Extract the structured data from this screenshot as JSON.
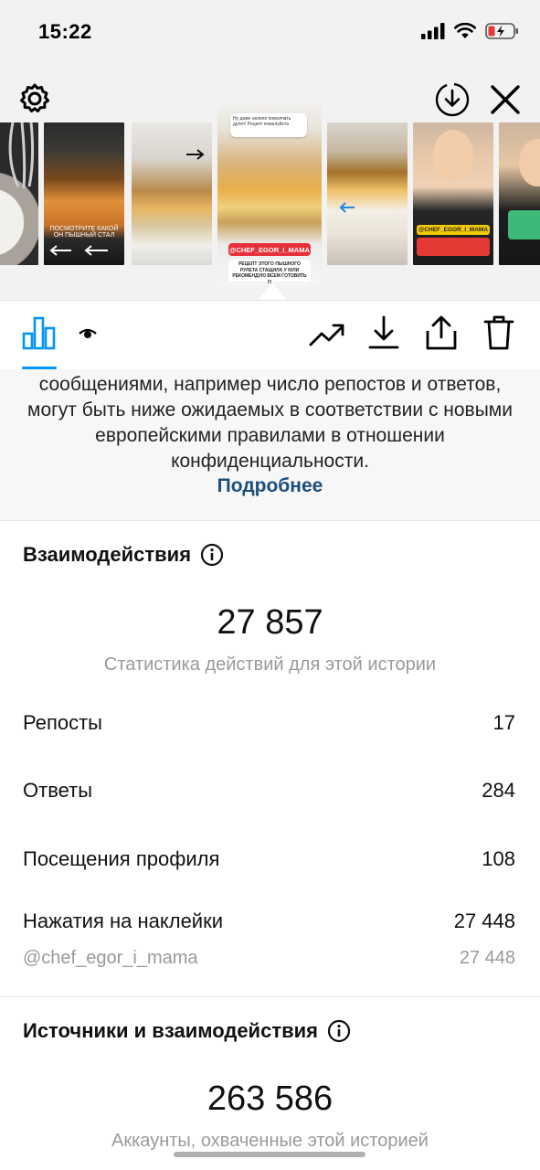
{
  "status_bar": {
    "time": "15:22"
  },
  "story_strip": {
    "thumbnails": [
      {
        "caption": ""
      },
      {
        "caption": "ПОСМОТРИТЕ КАКОЙ ОН ПЫШНЫЙ СТАЛ"
      },
      {
        "caption": ""
      },
      {
        "caption": "@CHEF_EGOR_I_MAMA"
      },
      {
        "caption": ""
      },
      {
        "caption": "@CHEF_EGOR_I_MAMA"
      },
      {
        "caption": ""
      }
    ],
    "selected_top_text": "Ну даже нелепо помолчать дулет! Рецепт пожалуйста",
    "selected_bottom_text": "РЕЦЕПТ ЭТОГО ПЫШНОГО РУЛЕТА СТАЩИЛА У ЮЛИ РЕКОМЕНДУЮ ВСЕМ ГОТОВИТЬ !!!"
  },
  "notice": {
    "text": "сообщениями, например число репостов и ответов, могут быть ниже ожидаемых в соответствии с новыми европейскими правилами в отношении конфиденциальности.",
    "link": "Подробнее"
  },
  "interactions": {
    "title": "Взаимодействия",
    "total": "27 857",
    "subtitle": "Статистика действий для этой истории",
    "rows": [
      {
        "label": "Репосты",
        "value": "17"
      },
      {
        "label": "Ответы",
        "value": "284"
      },
      {
        "label": "Посещения профиля",
        "value": "108"
      },
      {
        "label": "Нажатия на наклейки",
        "value": "27 448"
      }
    ],
    "sticker_sub": {
      "label": "@chef_egor_i_mama",
      "value": "27 448"
    }
  },
  "discovery": {
    "title": "Источники и взаимодействия",
    "total": "263 586",
    "subtitle": "Аккаунты, охваченные этой историей"
  },
  "colors": {
    "accent": "#0095f6",
    "link": "#1d4f7c",
    "sticker_red": "#e8303a"
  },
  "icons": {
    "settings": "gear-icon",
    "download_circle": "download-circle-icon",
    "close": "close-icon",
    "stats": "bar-chart-icon",
    "viewers": "eye-icon",
    "promote": "trending-up-icon",
    "save": "download-icon",
    "share": "share-icon",
    "delete": "trash-icon",
    "info": "info-icon"
  }
}
